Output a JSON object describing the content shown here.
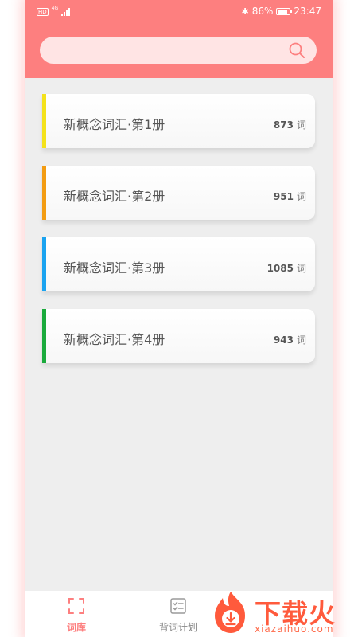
{
  "status_bar": {
    "network_badge": "HD",
    "network_type": "4G",
    "battery_percent": "86%",
    "battery_level": 0.86,
    "time": "23:47"
  },
  "search": {
    "value": "",
    "placeholder": ""
  },
  "books": [
    {
      "title": "新概念词汇·第1册",
      "count": "873",
      "unit": "词",
      "accent": "#f4e21b"
    },
    {
      "title": "新概念词汇·第2册",
      "count": "951",
      "unit": "词",
      "accent": "#f39c12"
    },
    {
      "title": "新概念词汇·第3册",
      "count": "1085",
      "unit": "词",
      "accent": "#1aa3f0"
    },
    {
      "title": "新概念词汇·第4册",
      "count": "943",
      "unit": "词",
      "accent": "#1aaa3c"
    }
  ],
  "tabs": [
    {
      "label": "词库",
      "active": true
    },
    {
      "label": "背词计划",
      "active": false
    }
  ],
  "watermark": {
    "text": "下载火",
    "url": "xiazaihuo.com"
  },
  "colors": {
    "header": "#fd7f7f",
    "search_bg": "#ffe4e4",
    "background": "#eeeeee",
    "active_tab": "#fd7f7f"
  },
  "icons": {
    "search": "search-icon",
    "library_tab": "scan-frame-icon",
    "plan_tab": "checklist-icon",
    "bluetooth": "bluetooth-icon",
    "battery": "battery-icon",
    "signal": "signal-bars-icon"
  }
}
